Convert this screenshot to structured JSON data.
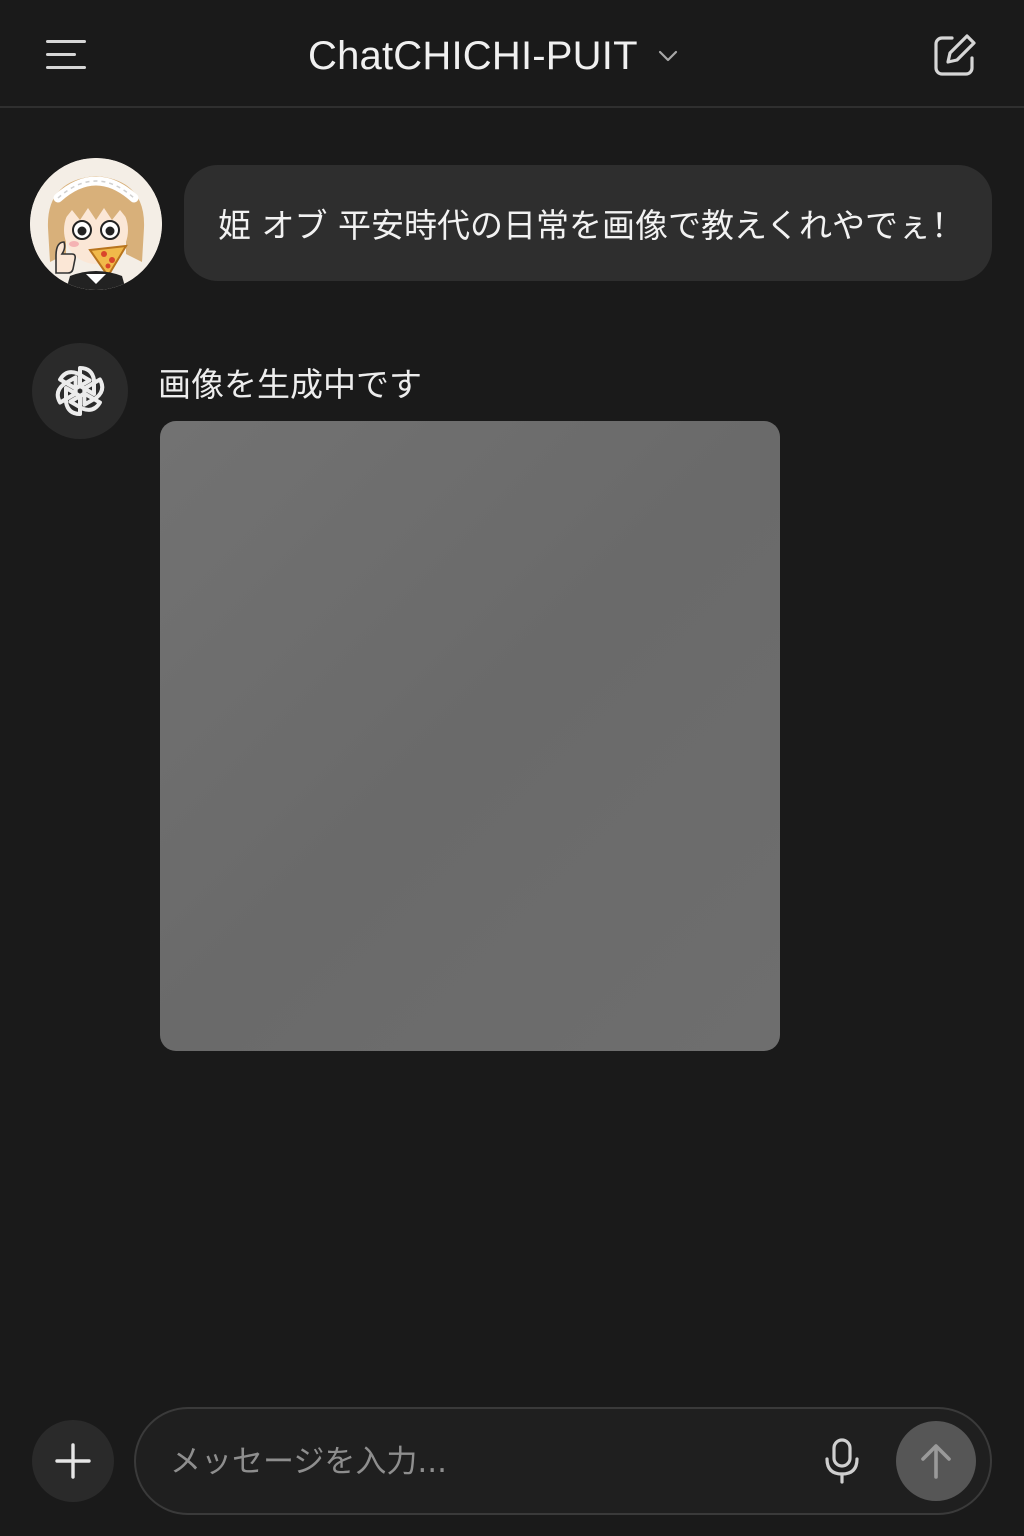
{
  "header": {
    "title": "ChatCHICHI-PUIT",
    "menu_icon": "hamburger-menu-icon",
    "dropdown_icon": "chevron-down-icon",
    "compose_icon": "new-chat-edit-icon"
  },
  "conversation": {
    "user_message": {
      "avatar": "user-avatar-maid-girl-eating-pizza",
      "text": "姫 オブ 平安時代の日常を画像で教えくれやでぇ！"
    },
    "assistant_message": {
      "icon": "openai-logo-icon",
      "status": "画像を生成中です",
      "image_state": "loading-placeholder"
    }
  },
  "composer": {
    "placeholder": "メッセージを入力...",
    "value": "",
    "plus_icon": "plus-icon",
    "mic_icon": "microphone-icon",
    "send_icon": "arrow-up-icon"
  },
  "colors": {
    "background": "#1a1a1a",
    "bubble": "#2e2e2e",
    "placeholder_image": "#6e6e6e",
    "send_button": "#565656"
  }
}
